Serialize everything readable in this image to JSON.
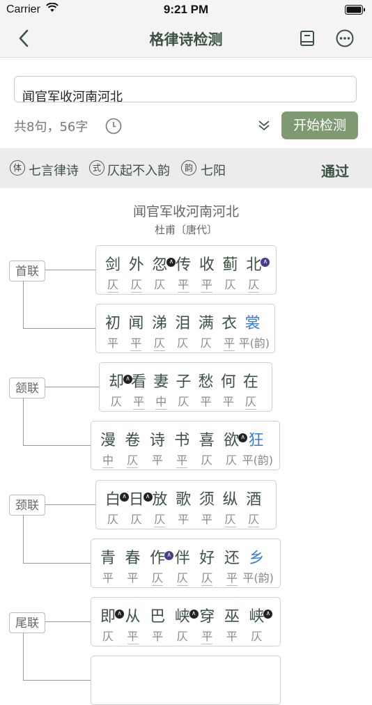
{
  "status": {
    "carrier": "Carrier",
    "time": "9:21 PM"
  },
  "nav": {
    "title": "格律诗检测"
  },
  "input": {
    "text": "闻官军收河南河北"
  },
  "stats": {
    "count": "共8句，56字"
  },
  "actions": {
    "start": "开始检测"
  },
  "info": {
    "badge1": "体",
    "form": "七言律诗",
    "badge2": "式",
    "pattern": "仄起不入韵",
    "badge3": "韵",
    "rhyme": "七阳",
    "result": "通过"
  },
  "poem": {
    "title": "闻官军收河南河北",
    "author": "杜甫〔唐代〕"
  },
  "lian": [
    "首联",
    "颔联",
    "颈联",
    "尾联"
  ],
  "lines": [
    {
      "chars": [
        "剑",
        "外",
        "忽",
        "传",
        "收",
        "蓟",
        "北"
      ],
      "tones": [
        "仄",
        "仄",
        "仄",
        "平",
        "平",
        "仄",
        "仄"
      ],
      "under": [
        1,
        1,
        0,
        1,
        1,
        0,
        1
      ],
      "marks": [
        0,
        0,
        1,
        0,
        0,
        0,
        2
      ],
      "rhyme": false
    },
    {
      "chars": [
        "初",
        "闻",
        "涕",
        "泪",
        "满",
        "衣",
        "裳"
      ],
      "tones": [
        "平",
        "平",
        "仄",
        "仄",
        "仄",
        "平",
        "平(韵)"
      ],
      "under": [
        0,
        1,
        1,
        0,
        0,
        1,
        0
      ],
      "marks": [
        0,
        0,
        0,
        0,
        0,
        0,
        0
      ],
      "rhyme": true
    },
    {
      "chars": [
        "却",
        "看",
        "妻",
        "子",
        "愁",
        "何",
        "在"
      ],
      "tones": [
        "仄",
        "平",
        "中",
        "仄",
        "平",
        "平",
        "仄"
      ],
      "under": [
        0,
        1,
        1,
        0,
        0,
        0,
        1
      ],
      "marks": [
        1,
        0,
        0,
        0,
        0,
        0,
        0
      ],
      "rhyme": false
    },
    {
      "chars": [
        "漫",
        "卷",
        "诗",
        "书",
        "喜",
        "欲",
        "狂"
      ],
      "tones": [
        "中",
        "仄",
        "平",
        "平",
        "仄",
        "仄",
        "平(韵)"
      ],
      "under": [
        1,
        1,
        0,
        1,
        0,
        0,
        0
      ],
      "marks": [
        0,
        0,
        0,
        0,
        0,
        1,
        0
      ],
      "rhyme": true
    },
    {
      "chars": [
        "白",
        "日",
        "放",
        "歌",
        "须",
        "纵",
        "酒"
      ],
      "tones": [
        "仄",
        "仄",
        "仄",
        "平",
        "平",
        "仄",
        "仄"
      ],
      "under": [
        0,
        0,
        1,
        0,
        0,
        1,
        1
      ],
      "marks": [
        1,
        1,
        0,
        0,
        0,
        0,
        0
      ],
      "rhyme": false
    },
    {
      "chars": [
        "青",
        "春",
        "作",
        "伴",
        "好",
        "还",
        "乡"
      ],
      "tones": [
        "平",
        "平",
        "仄",
        "仄",
        "仄",
        "平",
        "平(韵)"
      ],
      "under": [
        0,
        0,
        1,
        1,
        1,
        1,
        0
      ],
      "marks": [
        0,
        0,
        2,
        0,
        0,
        0,
        0
      ],
      "rhyme": true
    },
    {
      "chars": [
        "即",
        "从",
        "巴",
        "峡",
        "穿",
        "巫",
        "峡"
      ],
      "tones": [
        "仄",
        "平",
        "平",
        "仄",
        "平",
        "平",
        "仄"
      ],
      "under": [
        0,
        1,
        0,
        0,
        1,
        0,
        0
      ],
      "marks": [
        1,
        0,
        0,
        1,
        0,
        0,
        1
      ],
      "rhyme": false
    },
    {
      "chars": [
        "",
        "",
        "",
        "",
        "",
        "",
        ""
      ],
      "tones": [
        "",
        "",
        "",
        "",
        "",
        "",
        ""
      ],
      "under": [
        0,
        0,
        0,
        0,
        0,
        0,
        0
      ],
      "marks": [
        0,
        0,
        0,
        0,
        0,
        0,
        0
      ],
      "rhyme": false
    }
  ],
  "colors": {
    "accent": "#7f9a73",
    "text": "#3d5244",
    "rhyme": "#3b7fd9"
  }
}
